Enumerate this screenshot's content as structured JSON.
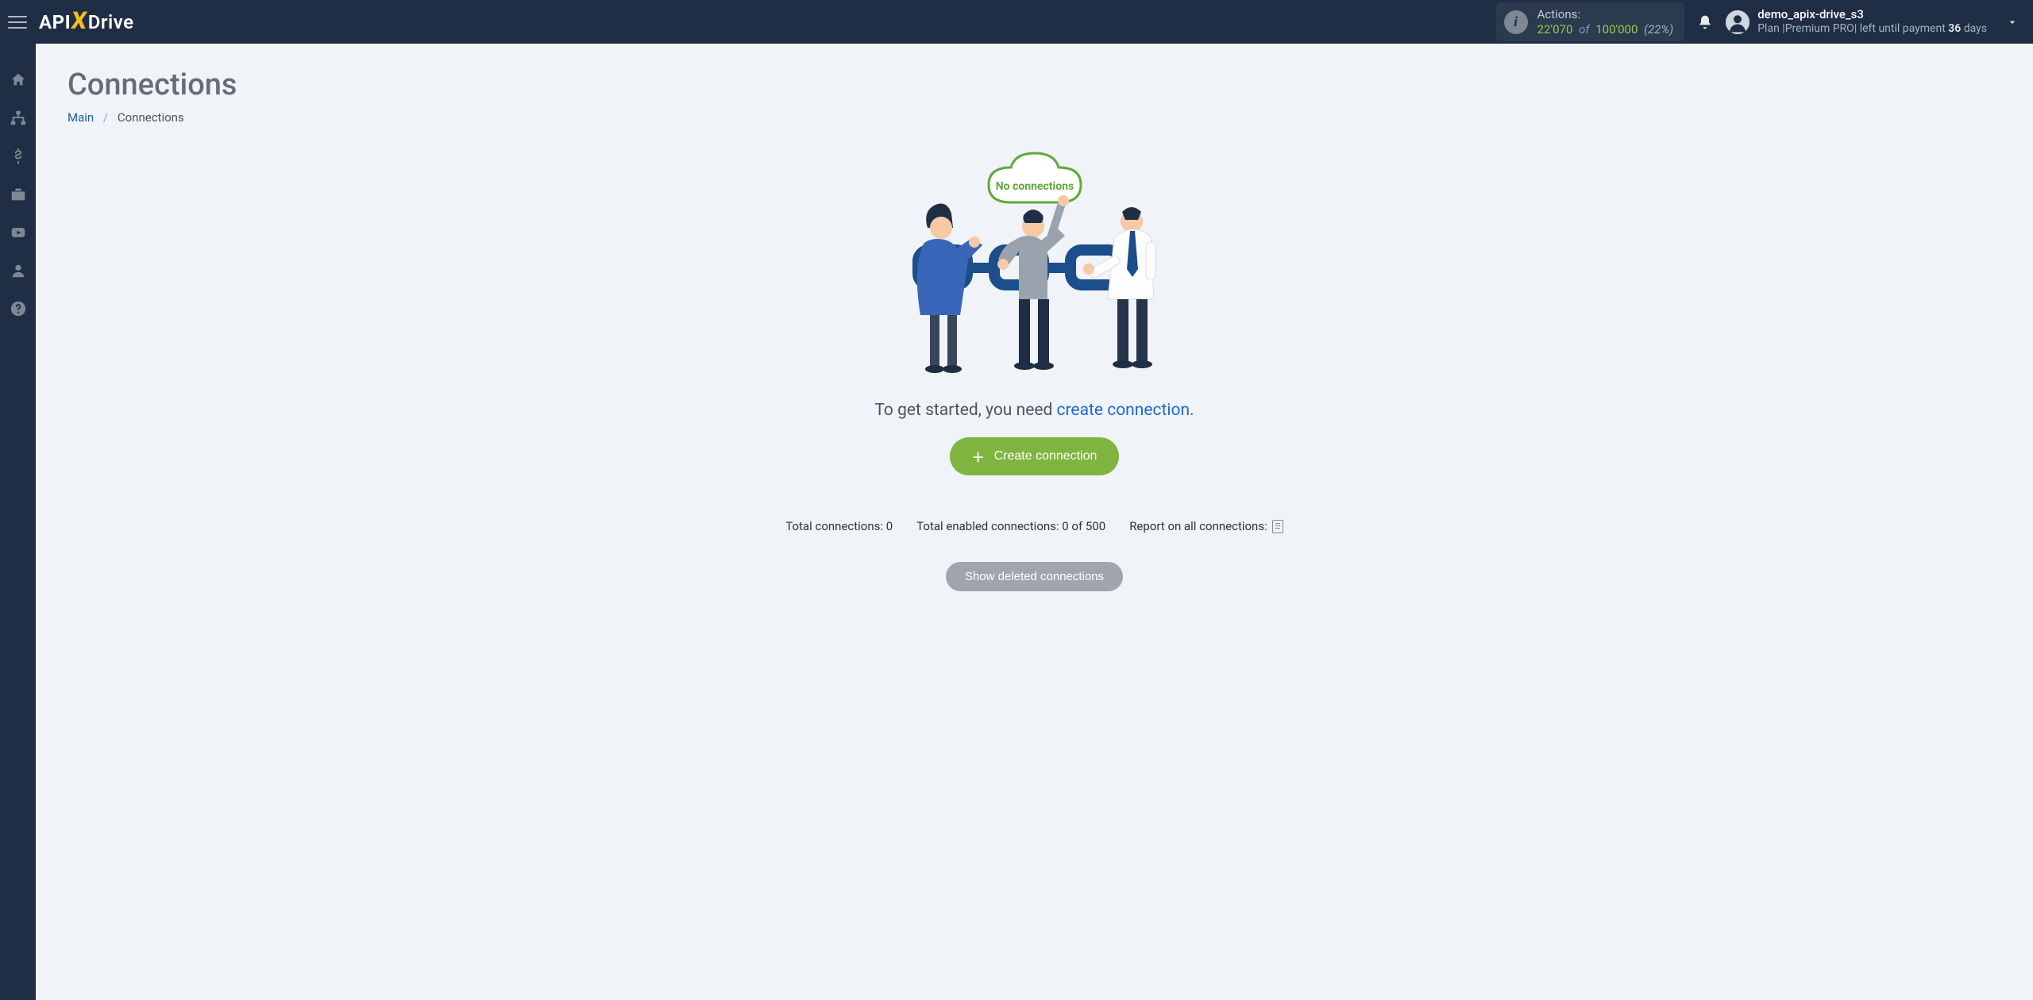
{
  "logo": {
    "part1": "API",
    "part2": "X",
    "part3": "Drive"
  },
  "header": {
    "actions": {
      "label": "Actions:",
      "used": "22'070",
      "of_word": "of",
      "limit": "100'000",
      "percent": "(22%)"
    },
    "user": {
      "name": "demo_apix-drive_s3",
      "plan_prefix": "Plan |",
      "plan_name": "Premium PRO",
      "plan_mid": "| left until payment ",
      "days_num": "36",
      "days_word": " days"
    }
  },
  "sidebar": {
    "items": [
      {
        "name": "home-icon"
      },
      {
        "name": "sitemap-icon"
      },
      {
        "name": "dollar-icon"
      },
      {
        "name": "briefcase-icon"
      },
      {
        "name": "play-icon"
      },
      {
        "name": "user-icon"
      },
      {
        "name": "help-icon"
      }
    ]
  },
  "page": {
    "title": "Connections",
    "breadcrumb": {
      "main": "Main",
      "current": "Connections"
    },
    "illustration_cloud": "No connections",
    "lead_prefix": "To get started, you need ",
    "lead_link": "create connection",
    "lead_suffix": ".",
    "create_button": "Create connection",
    "stats": {
      "total": "Total connections: 0",
      "enabled": "Total enabled connections: 0 of 500",
      "report": "Report on all connections:"
    },
    "show_deleted": "Show deleted connections"
  }
}
